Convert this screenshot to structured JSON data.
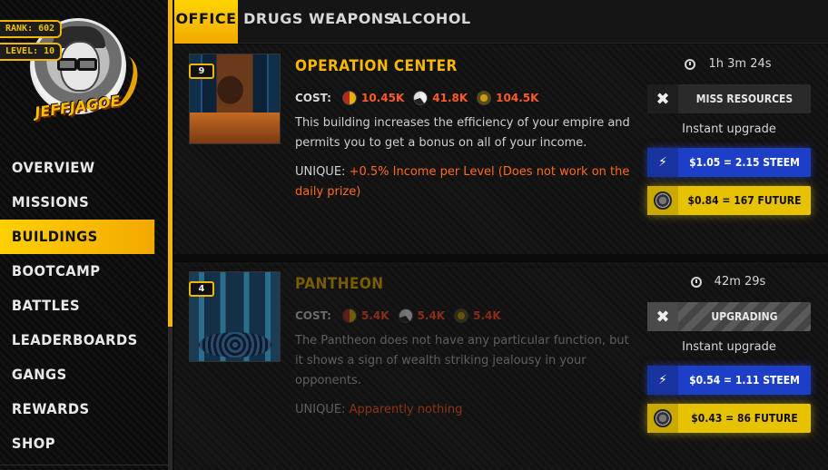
{
  "profile": {
    "rank_label": "RANK: 602",
    "level_label": "LEVEL: 10",
    "username": "JEFFJAGOE"
  },
  "nav": {
    "items": [
      {
        "label": "OVERVIEW"
      },
      {
        "label": "MISSIONS"
      },
      {
        "label": "BUILDINGS"
      },
      {
        "label": "BOOTCAMP"
      },
      {
        "label": "BATTLES"
      },
      {
        "label": "LEADERBOARDS"
      },
      {
        "label": "GANGS"
      },
      {
        "label": "REWARDS"
      },
      {
        "label": "SHOP"
      }
    ],
    "active": "BUILDINGS"
  },
  "tabs": {
    "office": "OFFICE",
    "drugs": "DRUGS",
    "weapons": "WEAPONS",
    "alcohol": "ALCOHOL",
    "active": "OFFICE"
  },
  "buildings": [
    {
      "level": "9",
      "name": "OPERATION CENTER",
      "cost_label": "COST:",
      "cost": {
        "drugs": "10.45K",
        "weapons": "41.8K",
        "alcohol": "104.5K"
      },
      "description": "This building increases the efficiency of your empire and permits you to get a bonus on all of your income.",
      "unique_label": "UNIQUE:",
      "unique_value": "+0.5% Income per Level (Does not work on the daily prize)",
      "timer": "1h 3m 24s",
      "status": "MISS RESOURCES",
      "instant_label": "Instant upgrade",
      "steem_price": "$1.05 = 2.15 STEEM",
      "future_price": "$0.84 = 167 FUTURE"
    },
    {
      "level": "4",
      "name": "PANTHEON",
      "cost_label": "COST:",
      "cost": {
        "drugs": "5.4K",
        "weapons": "5.4K",
        "alcohol": "5.4K"
      },
      "description": "The Pantheon does not have any particular function, but it shows a sign of wealth striking jealousy in your opponents.",
      "unique_label": "UNIQUE:",
      "unique_value": "Apparently nothing",
      "timer": "42m 29s",
      "status": "UPGRADING",
      "instant_label": "Instant upgrade",
      "steem_price": "$0.54 = 1.11 STEEM",
      "future_price": "$0.43 = 86 FUTURE"
    }
  ],
  "icons": {
    "clock": "clock-icon",
    "tools": "tools-icon",
    "lightning": "lightning-icon",
    "future_coin": "future-coin-icon",
    "drugs": "drugs-resource-icon",
    "weapons": "weapons-resource-icon",
    "alcohol": "alcohol-resource-icon"
  },
  "colors": {
    "accent": "#f2b705",
    "steem": "#1d3fc7",
    "future": "#e6c200",
    "cost_active": "#ff5a2a",
    "unique_active": "#ff6a1a"
  }
}
